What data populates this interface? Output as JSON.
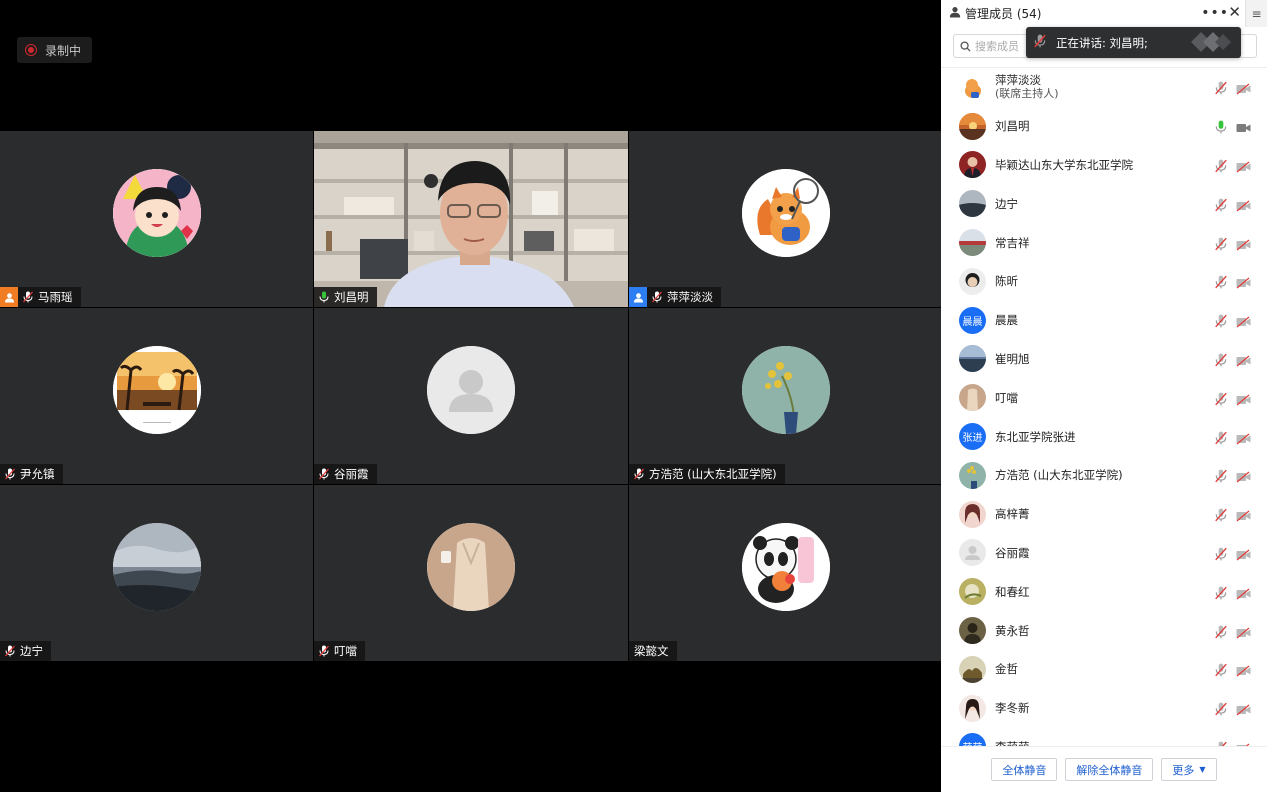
{
  "recording": {
    "label": "录制中"
  },
  "tiles": [
    {
      "name": "马雨瑶",
      "host": "orange"
    },
    {
      "name": "刘昌明",
      "host": ""
    },
    {
      "name": "萍萍淡淡",
      "host": "blue"
    },
    {
      "name": "尹允镇",
      "host": ""
    },
    {
      "name": "谷丽霞",
      "host": ""
    },
    {
      "name": "方浩范 (山大东北亚学院)",
      "host": ""
    },
    {
      "name": "边宁",
      "host": ""
    },
    {
      "name": "叮噹",
      "host": ""
    },
    {
      "name": "梁懿文",
      "host": ""
    }
  ],
  "sidebar": {
    "title": "管理成员 (54)",
    "search_placeholder": "搜索成员",
    "speaking_text": "正在讲话: 刘昌明;",
    "members": [
      {
        "name": "萍萍淡淡",
        "sub": "(联席主持人)",
        "avatar_text": ""
      },
      {
        "name": "刘昌明",
        "sub": "",
        "avatar_text": ""
      },
      {
        "name": "毕颖达山东大学东北亚学院",
        "sub": "",
        "avatar_text": ""
      },
      {
        "name": "边宁",
        "sub": "",
        "avatar_text": ""
      },
      {
        "name": "常吉祥",
        "sub": "",
        "avatar_text": ""
      },
      {
        "name": "陈昕",
        "sub": "",
        "avatar_text": ""
      },
      {
        "name": "晨晨",
        "sub": "",
        "avatar_text": "晨晨"
      },
      {
        "name": "崔明旭",
        "sub": "",
        "avatar_text": ""
      },
      {
        "name": "叮噹",
        "sub": "",
        "avatar_text": ""
      },
      {
        "name": "东北亚学院张进",
        "sub": "",
        "avatar_text": "张进"
      },
      {
        "name": "方浩范 (山大东北亚学院)",
        "sub": "",
        "avatar_text": ""
      },
      {
        "name": "高梓菁",
        "sub": "",
        "avatar_text": ""
      },
      {
        "name": "谷丽霞",
        "sub": "",
        "avatar_text": ""
      },
      {
        "name": "和春红",
        "sub": "",
        "avatar_text": ""
      },
      {
        "name": "黄永哲",
        "sub": "",
        "avatar_text": ""
      },
      {
        "name": "金哲",
        "sub": "",
        "avatar_text": ""
      },
      {
        "name": "李冬新",
        "sub": "",
        "avatar_text": ""
      },
      {
        "name": "李萌萌",
        "sub": "",
        "avatar_text": "萌萌"
      }
    ],
    "footer": {
      "mute_all": "全体静音",
      "unmute_all": "解除全体静音",
      "more": "更多"
    }
  },
  "colors": {
    "active_speaker_border": "#37c43b",
    "host_orange": "#f07c23",
    "host_blue": "#2d7ef2",
    "recording_red": "#d0272e",
    "mic_active_green": "#37c43b",
    "button_text_blue": "#1e5fcf"
  },
  "icons": {
    "recording": "record-dot-icon",
    "mic_muted": "mic-muted-icon",
    "mic_active": "mic-active-icon",
    "video_off": "video-off-icon",
    "video_on": "video-on-icon",
    "host": "host-person-icon",
    "search": "search-icon",
    "close": "close-icon",
    "more": "more-dots-icon",
    "menu": "menu-icon"
  }
}
